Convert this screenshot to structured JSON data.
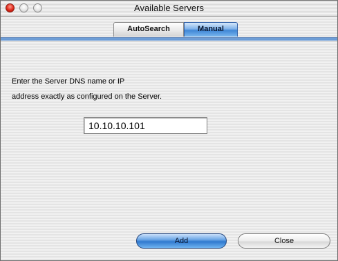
{
  "window": {
    "title": "Available Servers"
  },
  "tabs": [
    {
      "label": "AutoSearch",
      "selected": false
    },
    {
      "label": "Manual",
      "selected": true
    }
  ],
  "instruction": {
    "line1": "Enter the Server DNS name or IP",
    "line2": "address exactly as configured on the Server."
  },
  "server_field": {
    "value": "10.10.10.101"
  },
  "buttons": {
    "add_label": "Add",
    "close_label": "Close"
  },
  "colors": {
    "accent": "#3f86d6",
    "close_light": "#e0281a"
  }
}
